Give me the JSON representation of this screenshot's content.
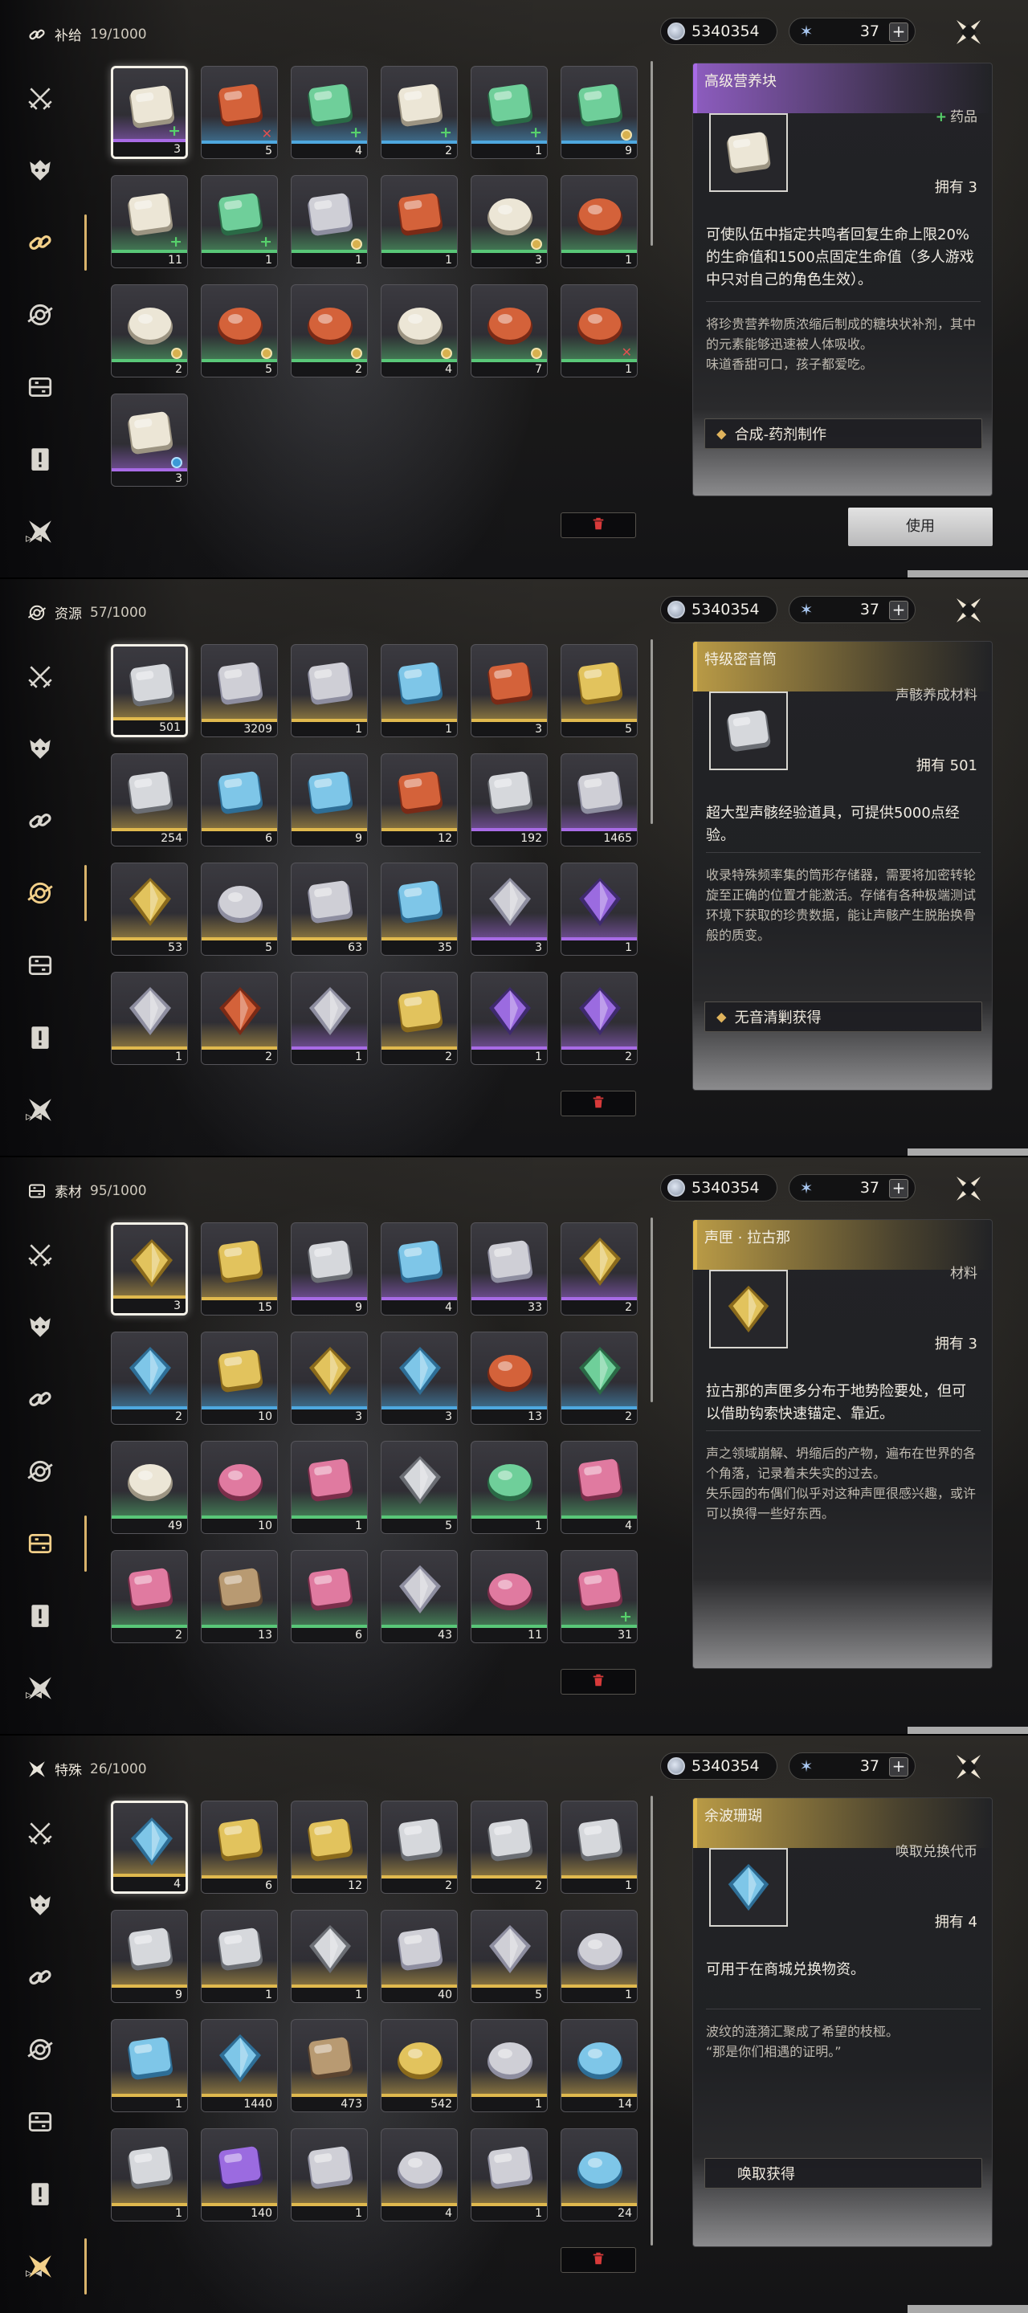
{
  "colors": {
    "rarity_purple": "#a86be6",
    "rarity_gold": "#e0b94e",
    "rarity_blue": "#4ea8e0",
    "rarity_green": "#59c778",
    "delete_red": "#d83a3a"
  },
  "shared": {
    "coins": "5340354",
    "stamina": "37",
    "stamina_plus": "+",
    "use_label": "使用"
  },
  "panels": [
    {
      "category": "补给",
      "count": "19/1000",
      "detail": {
        "name": "高级营养块",
        "type_plus": "+",
        "type": "药品",
        "owned": "拥有 3",
        "desc": "可使队伍中指定共鸣者回复生命上限20%的生命值和1500点固定生命值（多人游戏中只对自己的角色生效）。",
        "lore": "将珍贵营养物质浓缩后制成的糖块状补剂，其中的元素能够迅速被人体吸收。\n味道香甜可口，孩子都爱吃。",
        "source": "合成-药剂制作",
        "rarity": "purple"
      },
      "items": [
        {
          "qty": "3",
          "rarity": "purple",
          "icon": "ration-block-icon",
          "badge": "green",
          "selected": true
        },
        {
          "qty": "5",
          "rarity": "blue",
          "icon": "red-canister-icon",
          "badge": "red"
        },
        {
          "qty": "4",
          "rarity": "blue",
          "icon": "spray-bottle-icon",
          "badge": "green"
        },
        {
          "qty": "2",
          "rarity": "blue",
          "icon": "ration-block-icon",
          "badge": "green"
        },
        {
          "qty": "1",
          "rarity": "blue",
          "icon": "medicine-pack-icon",
          "badge": "green"
        },
        {
          "qty": "9",
          "rarity": "blue",
          "icon": "spray-bottle-icon",
          "badge": "gold"
        },
        {
          "qty": "11",
          "rarity": "green",
          "icon": "ration-block-icon",
          "badge": "green"
        },
        {
          "qty": "1",
          "rarity": "green",
          "icon": "medicine-pack-icon",
          "badge": "green"
        },
        {
          "qty": "1",
          "rarity": "green",
          "icon": "dark-device-icon",
          "badge": "gold"
        },
        {
          "qty": "1",
          "rarity": "green",
          "icon": "skewer-food-icon",
          "badge": ""
        },
        {
          "qty": "3",
          "rarity": "green",
          "icon": "dumpling-bowl-icon",
          "badge": "gold"
        },
        {
          "qty": "1",
          "rarity": "green",
          "icon": "soup-dish-icon",
          "badge": ""
        },
        {
          "qty": "2",
          "rarity": "green",
          "icon": "porridge-bowl-icon",
          "badge": "gold"
        },
        {
          "qty": "5",
          "rarity": "green",
          "icon": "stew-dish-icon",
          "badge": "gold"
        },
        {
          "qty": "2",
          "rarity": "green",
          "icon": "stew-dish-icon",
          "badge": "gold"
        },
        {
          "qty": "4",
          "rarity": "green",
          "icon": "porridge-bowl-icon",
          "badge": "gold"
        },
        {
          "qty": "7",
          "rarity": "green",
          "icon": "stew-dish-icon",
          "badge": "gold"
        },
        {
          "qty": "1",
          "rarity": "green",
          "icon": "soup-dish-icon",
          "badge": "red"
        },
        {
          "qty": "3",
          "rarity": "purple",
          "icon": "crumbled-snack-icon",
          "badge": "blue"
        }
      ]
    },
    {
      "category": "资源",
      "count": "57/1000",
      "detail": {
        "name": "特级密音筒",
        "type_plus": "",
        "type": "声骸养成材料",
        "owned": "拥有 501",
        "desc": "超大型声骸经验道具，可提供5000点经验。",
        "lore": "收录特殊频率集的筒形存储器，需要将加密转轮旋至正确的位置才能激活。存储有各种极端测试环境下获取的珍贵数据，能让声骸产生脱胎换骨般的质变。",
        "source": "无音清剿获得",
        "rarity": "gold"
      },
      "items": [
        {
          "qty": "501",
          "rarity": "gold",
          "icon": "sealed-tube-icon",
          "badge": "",
          "selected": true
        },
        {
          "qty": "3209",
          "rarity": "gold",
          "icon": "rock-core-icon",
          "badge": ""
        },
        {
          "qty": "1",
          "rarity": "gold",
          "icon": "wire-cube-icon",
          "badge": ""
        },
        {
          "qty": "1",
          "rarity": "gold",
          "icon": "blue-shell-icon",
          "badge": ""
        },
        {
          "qty": "3",
          "rarity": "gold",
          "icon": "red-machine-icon",
          "badge": ""
        },
        {
          "qty": "5",
          "rarity": "gold",
          "icon": "brass-tube-icon",
          "badge": ""
        },
        {
          "qty": "254",
          "rarity": "gold",
          "icon": "sealed-tube-icon",
          "badge": ""
        },
        {
          "qty": "6",
          "rarity": "gold",
          "icon": "swirl-shell-icon",
          "badge": ""
        },
        {
          "qty": "9",
          "rarity": "gold",
          "icon": "spiral-shell-icon",
          "badge": ""
        },
        {
          "qty": "12",
          "rarity": "gold",
          "icon": "ember-shell-icon",
          "badge": ""
        },
        {
          "qty": "192",
          "rarity": "purple",
          "icon": "sealed-tube-icon",
          "badge": ""
        },
        {
          "qty": "1465",
          "rarity": "purple",
          "icon": "rock-core-icon",
          "badge": ""
        },
        {
          "qty": "53",
          "rarity": "gold",
          "icon": "gold-star-icon",
          "badge": ""
        },
        {
          "qty": "5",
          "rarity": "gold",
          "icon": "dark-orb-icon",
          "badge": ""
        },
        {
          "qty": "63",
          "rarity": "gold",
          "icon": "wire-cube-icon",
          "badge": ""
        },
        {
          "qty": "35",
          "rarity": "gold",
          "icon": "blue-shell-icon",
          "badge": ""
        },
        {
          "qty": "3",
          "rarity": "purple",
          "icon": "spark-burst-icon",
          "badge": ""
        },
        {
          "qty": "1",
          "rarity": "purple",
          "icon": "violet-star-icon",
          "badge": ""
        },
        {
          "qty": "1",
          "rarity": "gold",
          "icon": "spark-burst-icon",
          "badge": ""
        },
        {
          "qty": "2",
          "rarity": "gold",
          "icon": "red-burst-icon",
          "badge": ""
        },
        {
          "qty": "1",
          "rarity": "purple",
          "icon": "flame-crescent-icon",
          "badge": ""
        },
        {
          "qty": "2",
          "rarity": "gold",
          "icon": "golden-emblem-icon",
          "badge": ""
        },
        {
          "qty": "1",
          "rarity": "purple",
          "icon": "violet-feather-icon",
          "badge": ""
        },
        {
          "qty": "2",
          "rarity": "purple",
          "icon": "violet-star-icon",
          "badge": ""
        }
      ]
    },
    {
      "category": "素材",
      "count": "95/1000",
      "detail": {
        "name": "声匣 · 拉古那",
        "type_plus": "",
        "type": "材料",
        "owned": "拥有 3",
        "desc": "拉古那的声匣多分布于地势险要处，但可以借助钩索快速锚定、靠近。",
        "lore": "声之领域崩解、坍缩后的产物，遍布在世界的各个角落，记录着未失实的过去。\n失乐园的布偶们似乎对这种声匣很感兴趣，或许可以换得一些好东西。",
        "source": "",
        "rarity": "gold"
      },
      "items": [
        {
          "qty": "3",
          "rarity": "gold",
          "icon": "gold-crystal-icon",
          "badge": "",
          "selected": true
        },
        {
          "qty": "15",
          "rarity": "gold",
          "icon": "amber-flask-icon",
          "badge": ""
        },
        {
          "qty": "9",
          "rarity": "purple",
          "icon": "metal-cube-icon",
          "badge": ""
        },
        {
          "qty": "4",
          "rarity": "purple",
          "icon": "blue-fish-icon",
          "badge": ""
        },
        {
          "qty": "33",
          "rarity": "purple",
          "icon": "orange-tablet-icon",
          "badge": ""
        },
        {
          "qty": "2",
          "rarity": "purple",
          "icon": "gold-crystal-icon",
          "badge": ""
        },
        {
          "qty": "2",
          "rarity": "blue",
          "icon": "cyan-crystal-icon",
          "badge": ""
        },
        {
          "qty": "10",
          "rarity": "blue",
          "icon": "amber-flask-icon",
          "badge": ""
        },
        {
          "qty": "3",
          "rarity": "blue",
          "icon": "gold-crystal-icon",
          "badge": ""
        },
        {
          "qty": "3",
          "rarity": "blue",
          "icon": "cyan-crystal-icon",
          "badge": ""
        },
        {
          "qty": "13",
          "rarity": "blue",
          "icon": "stew-dish-icon",
          "badge": ""
        },
        {
          "qty": "2",
          "rarity": "blue",
          "icon": "green-prism-icon",
          "badge": ""
        },
        {
          "qty": "49",
          "rarity": "green",
          "icon": "eggs-icon",
          "badge": ""
        },
        {
          "qty": "10",
          "rarity": "green",
          "icon": "red-fruit-icon",
          "badge": ""
        },
        {
          "qty": "1",
          "rarity": "green",
          "icon": "blue-flower-icon",
          "badge": ""
        },
        {
          "qty": "5",
          "rarity": "green",
          "icon": "silver-leaf-icon",
          "badge": ""
        },
        {
          "qty": "1",
          "rarity": "green",
          "icon": "lime-orb-icon",
          "badge": ""
        },
        {
          "qty": "4",
          "rarity": "green",
          "icon": "pink-flower-icon",
          "badge": ""
        },
        {
          "qty": "2",
          "rarity": "green",
          "icon": "red-flower-icon",
          "badge": ""
        },
        {
          "qty": "13",
          "rarity": "green",
          "icon": "mushroom-icon",
          "badge": ""
        },
        {
          "qty": "6",
          "rarity": "green",
          "icon": "white-flower-icon",
          "badge": ""
        },
        {
          "qty": "43",
          "rarity": "green",
          "icon": "coral-branch-icon",
          "badge": ""
        },
        {
          "qty": "11",
          "rarity": "green",
          "icon": "lantern-fruit-icon",
          "badge": ""
        },
        {
          "qty": "31",
          "rarity": "green",
          "icon": "pink-flower-icon",
          "badge": "green"
        }
      ]
    },
    {
      "category": "特殊",
      "count": "26/1000",
      "detail": {
        "name": "余波珊瑚",
        "type_plus": "",
        "type": "唤取兑换代币",
        "owned": "拥有 4",
        "desc": "可用于在商城兑换物资。",
        "lore": "波纹的涟漪汇聚成了希望的枝桠。\n“那是你们相遇的证明。”",
        "source": "唤取获得",
        "rarity": "gold"
      },
      "items": [
        {
          "qty": "4",
          "rarity": "gold",
          "icon": "prism-coral-icon",
          "badge": "",
          "selected": true
        },
        {
          "qty": "6",
          "rarity": "gold",
          "icon": "gold-chest-icon",
          "badge": ""
        },
        {
          "qty": "12",
          "rarity": "gold",
          "icon": "gold-chest-icon",
          "badge": ""
        },
        {
          "qty": "2",
          "rarity": "gold",
          "icon": "silver-chest-icon",
          "badge": ""
        },
        {
          "qty": "2",
          "rarity": "gold",
          "icon": "silver-chest-icon",
          "badge": ""
        },
        {
          "qty": "1",
          "rarity": "gold",
          "icon": "silver-chest-icon",
          "badge": ""
        },
        {
          "qty": "9",
          "rarity": "gold",
          "icon": "silver-chest-icon",
          "badge": ""
        },
        {
          "qty": "1",
          "rarity": "gold",
          "icon": "pass-card-icon",
          "badge": ""
        },
        {
          "qty": "1",
          "rarity": "gold",
          "icon": "crystal-shard-icon",
          "badge": ""
        },
        {
          "qty": "40",
          "rarity": "gold",
          "icon": "glow-cube-icon",
          "badge": ""
        },
        {
          "qty": "5",
          "rarity": "gold",
          "icon": "triangle-token-icon",
          "badge": ""
        },
        {
          "qty": "1",
          "rarity": "gold",
          "icon": "round-badge-icon",
          "badge": ""
        },
        {
          "qty": "1",
          "rarity": "gold",
          "icon": "blue-card-icon",
          "badge": ""
        },
        {
          "qty": "1440",
          "rarity": "gold",
          "icon": "cyan-coral-icon",
          "badge": ""
        },
        {
          "qty": "473",
          "rarity": "gold",
          "icon": "wood-plank-icon",
          "badge": ""
        },
        {
          "qty": "542",
          "rarity": "gold",
          "icon": "gold-coin-icon",
          "badge": ""
        },
        {
          "qty": "1",
          "rarity": "gold",
          "icon": "camera-icon",
          "badge": ""
        },
        {
          "qty": "14",
          "rarity": "gold",
          "icon": "blue-camera-icon",
          "badge": ""
        },
        {
          "qty": "1",
          "rarity": "gold",
          "icon": "silver-chest-icon",
          "badge": ""
        },
        {
          "qty": "140",
          "rarity": "gold",
          "icon": "violet-chest-icon",
          "badge": ""
        },
        {
          "qty": "1",
          "rarity": "gold",
          "icon": "ring-charm-icon",
          "badge": ""
        },
        {
          "qty": "4",
          "rarity": "gold",
          "icon": "camera-icon",
          "badge": ""
        },
        {
          "qty": "1",
          "rarity": "gold",
          "icon": "open-box-icon",
          "badge": ""
        },
        {
          "qty": "24",
          "rarity": "gold",
          "icon": "blue-camera-icon",
          "badge": ""
        }
      ]
    }
  ]
}
